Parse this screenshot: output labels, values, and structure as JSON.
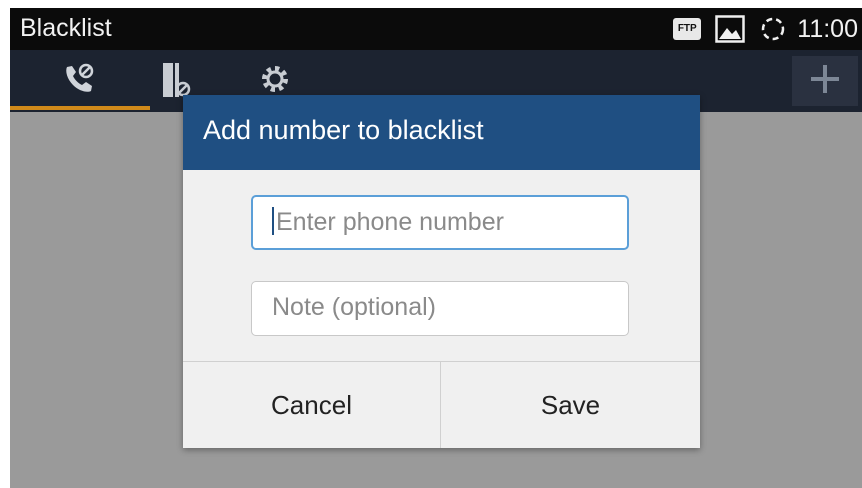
{
  "status_bar": {
    "title": "Blacklist",
    "ftp_label": "FTP",
    "time": "11:00"
  },
  "tabs": [
    {
      "icon": "call-block-icon",
      "active": true
    },
    {
      "icon": "contacts-block-icon",
      "active": false
    },
    {
      "icon": "gear-icon",
      "active": false
    }
  ],
  "add_button_icon": "plus-icon",
  "dialog": {
    "title": "Add number to blacklist",
    "phone_placeholder": "Enter phone number",
    "note_placeholder": "Note (optional)",
    "cancel_label": "Cancel",
    "save_label": "Save"
  },
  "colors": {
    "dialog_header": "#1f4f82",
    "tab_accent": "#d08a1a",
    "focused_field_border": "#5b9fd8"
  }
}
